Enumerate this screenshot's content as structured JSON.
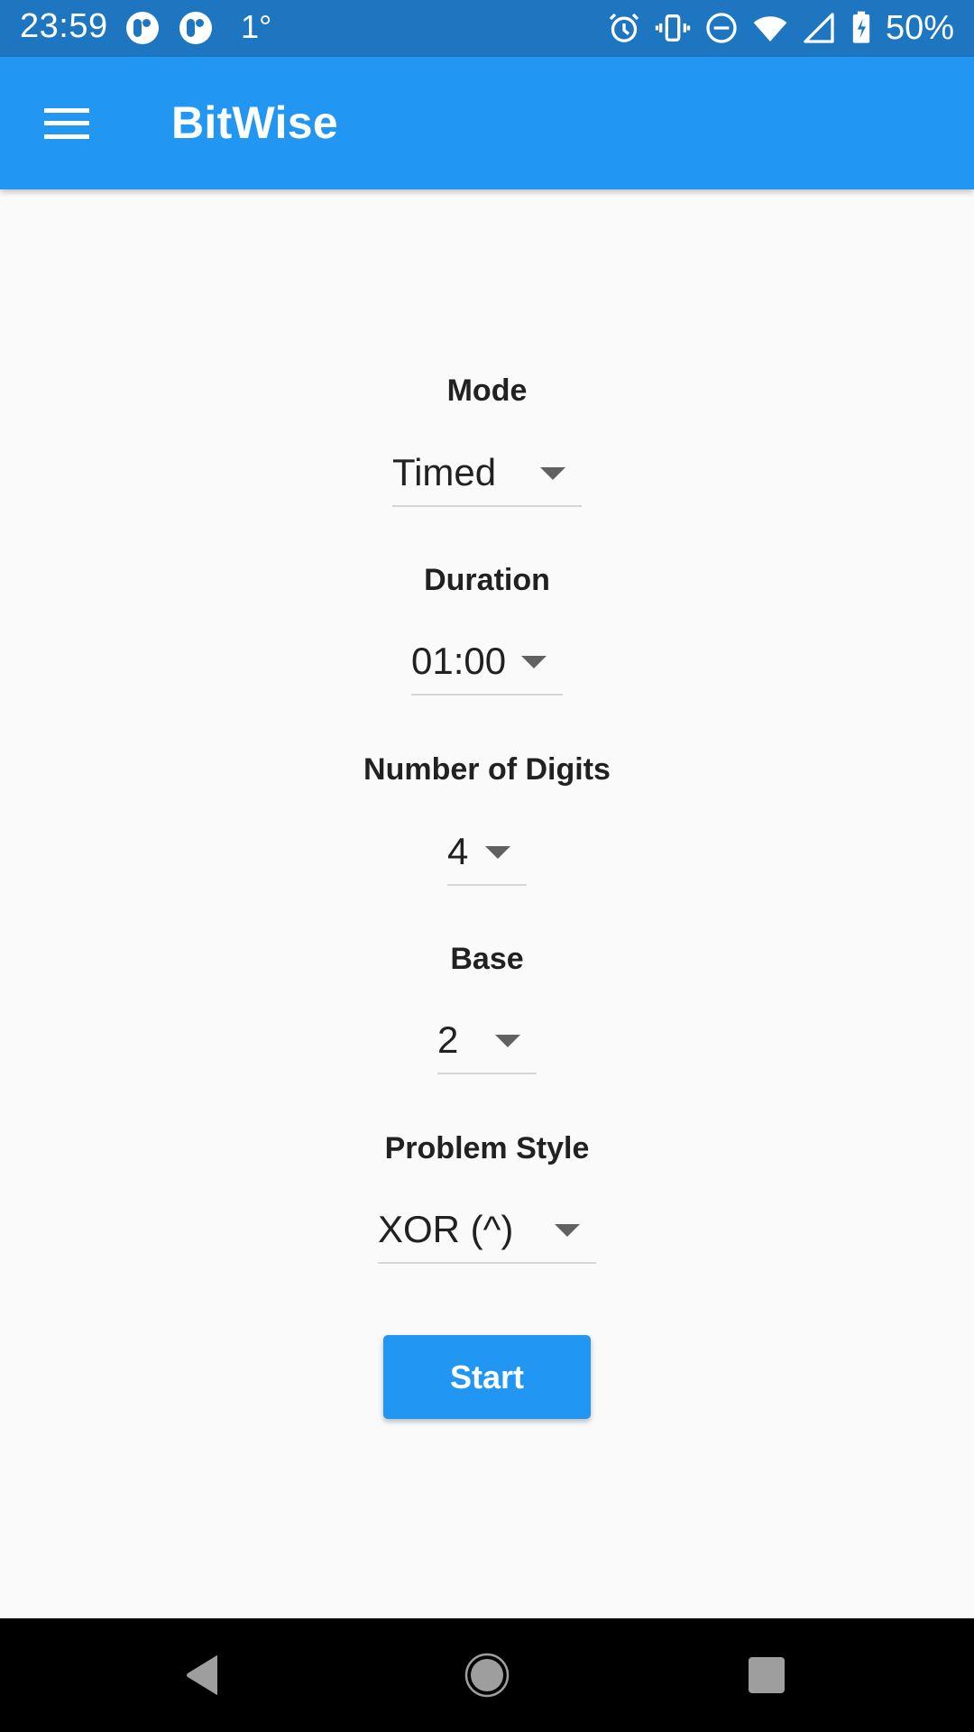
{
  "status_bar": {
    "time": "23:59",
    "temperature": "1°",
    "battery_percent": "50%",
    "left_icons": [
      "app-notification-icon",
      "app-notification-icon"
    ],
    "right_icons": [
      "alarm-icon",
      "vibrate-icon",
      "do-not-disturb-icon",
      "wifi-icon",
      "cell-signal-icon",
      "battery-charging-icon"
    ]
  },
  "app_bar": {
    "menu_icon": "hamburger-menu-icon",
    "title": "BitWise"
  },
  "form": {
    "fields": [
      {
        "label": "Mode",
        "value": "Timed"
      },
      {
        "label": "Duration",
        "value": "01:00"
      },
      {
        "label": "Number of Digits",
        "value": "4"
      },
      {
        "label": "Base",
        "value": "2"
      },
      {
        "label": "Problem Style",
        "value": "XOR (^)"
      }
    ],
    "start_label": "Start"
  },
  "nav_bar": {
    "buttons": [
      "back-icon",
      "home-icon",
      "recents-icon"
    ]
  },
  "colors": {
    "primary": "#2196f3",
    "status_bar": "#1e76c0",
    "background": "#fafafa"
  }
}
